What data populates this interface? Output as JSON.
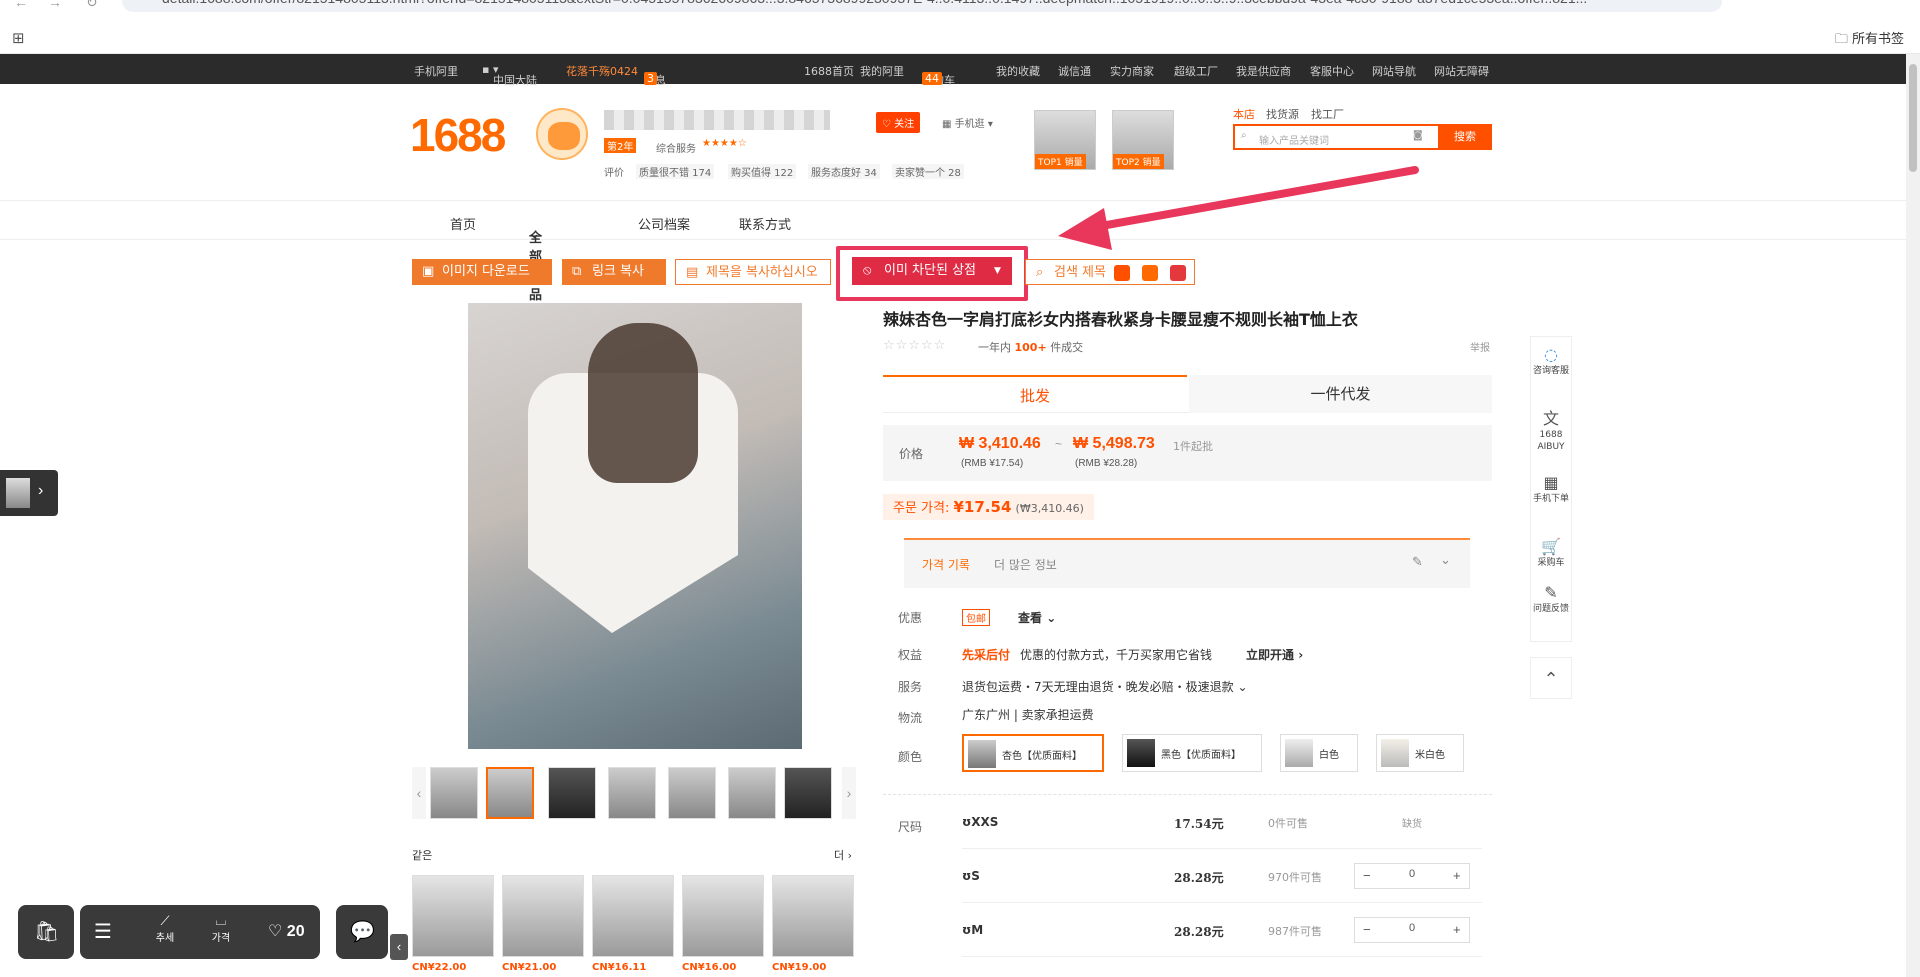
{
  "browser": {
    "url": "detail.1688.com/offer/821514805113.html?offerId=821514805113&extStr=0.04515578362609863...3.8465736899230937E-4..0.4113..0.1497..deepmatch..1051919..0..0..3..9..3cebbd9a-43ea-4c30-9188-a37ed1ce53ea..offer..821...",
    "bookmarks_label": "所有书签"
  },
  "topbar": {
    "items": [
      "手机阿里",
      "中国大陆",
      "花落千殇0424",
      "消息",
      "1688首页",
      "我的阿里",
      "采购车",
      "我的收藏",
      "诚信通",
      "实力商家",
      "超级工厂",
      "我是供应商",
      "客服中心",
      "网站导航",
      "网站无障碍"
    ],
    "message_count": "3",
    "cart_count": "44"
  },
  "header": {
    "logo": "1688",
    "shop_years": "第2年",
    "shop_score_label": "综合服务",
    "review_label": "评价",
    "review_tags": [
      "质量很不错 174",
      "购买值得 122",
      "服务态度好 34",
      "卖家赞一个 28"
    ],
    "follow_label": "关注",
    "mobile_label": "手机逛",
    "top1_label": "TOP1 销量",
    "top2_label": "TOP2 销量",
    "search_tabs": [
      "本店",
      "找货源",
      "找工厂"
    ],
    "search_placeholder": "输入产品关键词",
    "search_button": "搜索"
  },
  "shopnav": [
    "首页",
    "全部商品",
    "公司档案",
    "联系方式"
  ],
  "toolbar": {
    "download_images": "이미지 다운로드",
    "copy_link": "링크 복사",
    "copy_title": "제목을 복사하십시오",
    "blocked_shop": "이미 차단된 상점",
    "search_title": "검색 제목"
  },
  "product": {
    "title": "辣妹杏色一字肩打底衫女内搭春秋紧身卡腰显瘦不规则长袖T恤上衣",
    "sales_prefix": "一年内",
    "sales_count": "100+",
    "sales_suffix": "件成交",
    "report": "举报",
    "tab_wholesale": "批发",
    "tab_dropship": "一件代发",
    "price_label": "价格",
    "price_low": "₩ 3,410.46",
    "price_sep": "~",
    "price_high": "₩ 5,498.73",
    "min_order": "1件起批",
    "price_low_rmb": "(RMB ¥17.54)",
    "price_high_rmb": "(RMB ¥28.28)",
    "order_price_label": "주문 가격:",
    "order_price": "¥17.54",
    "order_price_krw": "(₩3,410.46)",
    "history_label": "가격 기록",
    "history_more": "더 많은 정보",
    "promo_label": "优惠",
    "promo_badge": "包邮",
    "promo_view": "查看",
    "rights_label": "权益",
    "rights_highlight": "先采后付",
    "rights_text": "优惠的付款方式，千万买家用它省钱",
    "rights_action": "立即开通",
    "service_label": "服务",
    "service_text": "退货包运费・7天无理由退货・晚发必赔・极速退款",
    "logistics_label": "物流",
    "logistics_text": "广东广州 | 卖家承担运费",
    "color_label": "颜色",
    "colors": [
      "杏色【优质面料】",
      "黑色【优质面料】",
      "白色",
      "米白色"
    ],
    "size_label": "尺码",
    "sizes": [
      {
        "name": "XXS",
        "price": "17.54元",
        "stock": "0件可售",
        "action": "缺货"
      },
      {
        "name": "S",
        "price": "28.28元",
        "stock": "970件可售",
        "qty": "0"
      },
      {
        "name": "M",
        "price": "28.28元",
        "stock": "987件可售",
        "qty": "0"
      }
    ]
  },
  "similar": {
    "title": "같은",
    "more": "더",
    "prices": [
      "CN¥22.00",
      "CN¥21.00",
      "CN¥16.11",
      "CN¥16.00",
      "CN¥19.00"
    ]
  },
  "sidefloat": [
    "咨询客服",
    "1688 AIBUY",
    "手机下单",
    "采购车",
    "问题反馈"
  ],
  "bottombar": {
    "trend_label": "추세",
    "price_label": "가격",
    "like_count": "20"
  },
  "colors": {
    "accent": "#ff6a00",
    "blocked": "#e02b45",
    "arrow": "#e8375a"
  }
}
